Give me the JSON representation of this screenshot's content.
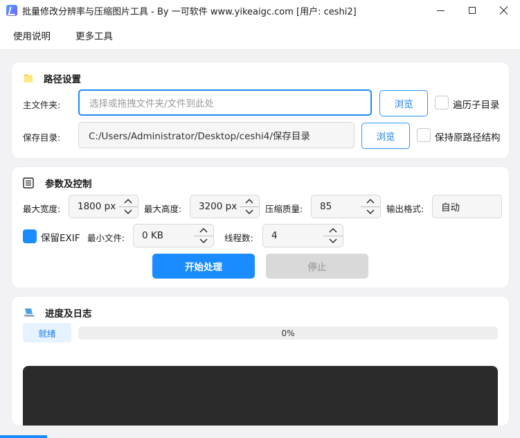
{
  "window": {
    "title": "批量修改分辨率与压缩图片工具 - By 一可软件 www.yikeaigc.com [用户: ceshi2]"
  },
  "menu": {
    "items": [
      {
        "label": "使用说明"
      },
      {
        "label": "更多工具"
      }
    ]
  },
  "path_settings": {
    "title": "路径设置",
    "main_folder": {
      "label": "主文件夹:",
      "placeholder": "选择或拖拽文件夹/文件到此处",
      "value": "",
      "browse_label": "浏览",
      "checkbox_label": "遍历子目录",
      "checked": false
    },
    "save_dir": {
      "label": "保存目录:",
      "value": "C:/Users/Administrator/Desktop/ceshi4/保存目录",
      "browse_label": "浏览",
      "checkbox_label": "保持原路径结构",
      "checked": false
    }
  },
  "params": {
    "title": "参数及控制",
    "max_width": {
      "label": "最大宽度:",
      "value": "1800 px"
    },
    "max_height": {
      "label": "最大高度:",
      "value": "3200 px"
    },
    "quality": {
      "label": "压缩质量:",
      "value": "85"
    },
    "format": {
      "label": "输出格式:",
      "value": "自动"
    },
    "keep_exif": {
      "label": "保留EXIF",
      "checked": true
    },
    "min_file": {
      "label": "最小文件:",
      "value": "0 KB"
    },
    "threads": {
      "label": "线程数:",
      "value": "4"
    },
    "start_label": "开始处理",
    "stop_label": "停止"
  },
  "progress": {
    "title": "进度及日志",
    "status": "就绪",
    "percent_text": "0%",
    "fraction": 0
  },
  "colors": {
    "accent": "#1a8cff",
    "log_background": "#2b2b2b"
  }
}
